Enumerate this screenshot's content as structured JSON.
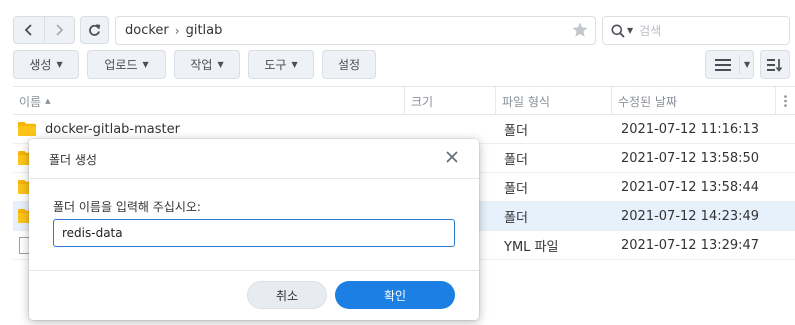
{
  "nav": {
    "path_segments": [
      "docker",
      "gitlab"
    ],
    "search_placeholder": "검색"
  },
  "toolbar": {
    "create_label": "생성",
    "upload_label": "업로드",
    "action_label": "작업",
    "tools_label": "도구",
    "settings_label": "설정"
  },
  "file_list": {
    "columns": {
      "name": "이름",
      "size": "크기",
      "type": "파일 형식",
      "modified": "수정된 날짜"
    },
    "rows": [
      {
        "name": "docker-gitlab-master",
        "type": "폴더",
        "modified": "2021-07-12 11:16:13"
      },
      {
        "type": "폴더",
        "modified": "2021-07-12 13:58:50"
      },
      {
        "type": "폴더",
        "modified": "2021-07-12 13:58:44"
      },
      {
        "type": "폴더",
        "modified": "2021-07-12 14:23:49"
      },
      {
        "type": "YML 파일",
        "modified": "2021-07-12 13:29:47"
      }
    ]
  },
  "dialog": {
    "title": "폴더 생성",
    "prompt": "폴더 이름을 입력해 주십시오:",
    "input_value": "redis-data",
    "cancel_label": "취소",
    "confirm_label": "확인"
  },
  "colors": {
    "accent": "#1b7fe3",
    "folder": "#f7b500",
    "selected_row": "#e7f1fb"
  }
}
